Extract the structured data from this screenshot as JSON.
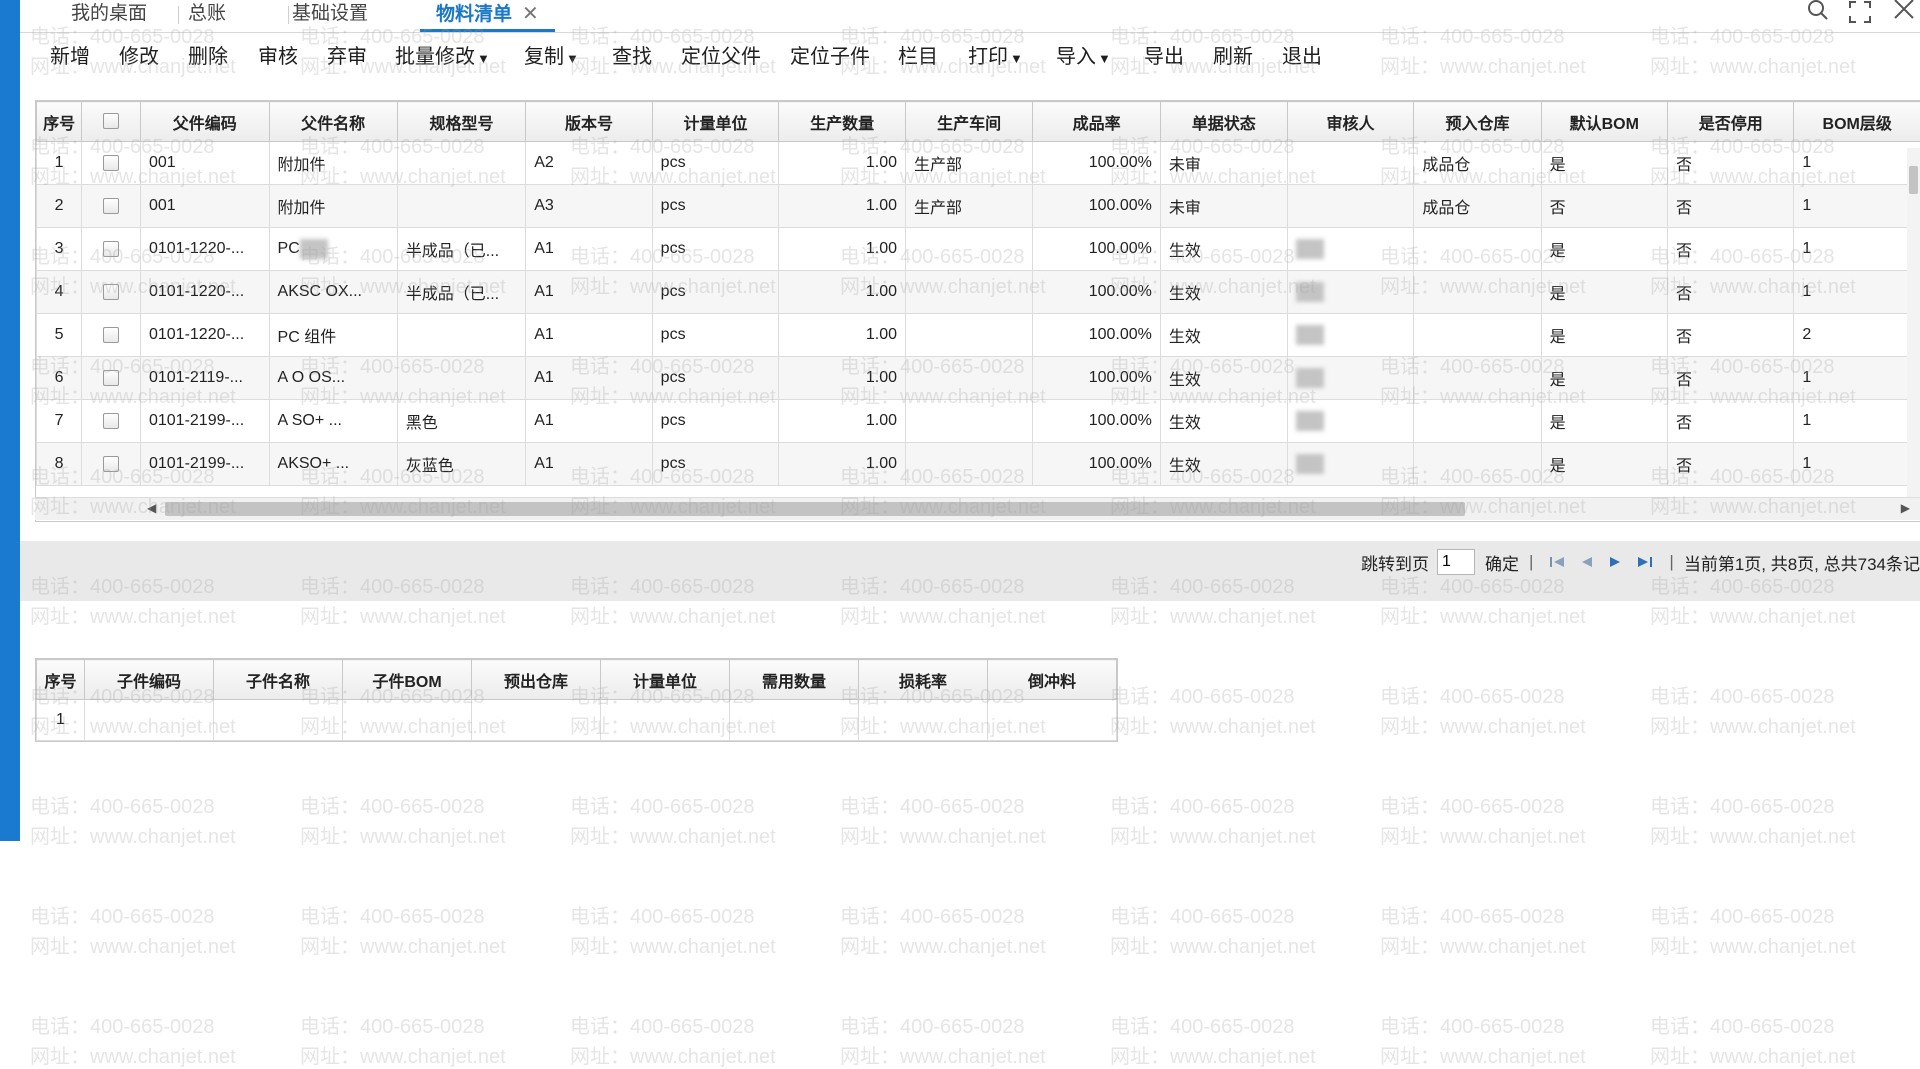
{
  "tabs": [
    {
      "label": "我的桌面"
    },
    {
      "label": "总账"
    },
    {
      "label": "基础设置"
    },
    {
      "label": "物料清单",
      "active": true,
      "close": "✕"
    }
  ],
  "toolbar": [
    {
      "label": "新增"
    },
    {
      "label": "修改"
    },
    {
      "label": "删除"
    },
    {
      "label": "审核"
    },
    {
      "label": "弃审"
    },
    {
      "label": "批量修改",
      "dropdown": true
    },
    {
      "label": "复制",
      "dropdown": true
    },
    {
      "label": "查找"
    },
    {
      "label": "定位父件"
    },
    {
      "label": "定位子件"
    },
    {
      "label": "栏目"
    },
    {
      "label": "打印",
      "dropdown": true
    },
    {
      "label": "导入",
      "dropdown": true
    },
    {
      "label": "导出"
    },
    {
      "label": "刷新"
    },
    {
      "label": "退出"
    }
  ],
  "main_grid": {
    "columns": [
      "序号",
      "",
      "父件编码",
      "父件名称",
      "规格型号",
      "版本号",
      "计量单位",
      "生产数量",
      "生产车间",
      "成品率",
      "单据状态",
      "审核人",
      "预入仓库",
      "默认BOM",
      "是否停用",
      "BOM层级"
    ],
    "rows": [
      [
        "1",
        "",
        "001",
        "附加件",
        "",
        "A2",
        "pcs",
        "1.00",
        "生产部",
        "100.00%",
        "未审",
        "",
        "成品仓",
        "是",
        "否",
        "1"
      ],
      [
        "2",
        "",
        "001",
        "附加件",
        "",
        "A3",
        "pcs",
        "1.00",
        "生产部",
        "100.00%",
        "未审",
        "",
        "成品仓",
        "否",
        "否",
        "1"
      ],
      [
        "3",
        "",
        "0101-1220-...",
        "PC",
        "半成品（已...",
        "A1",
        "pcs",
        "1.00",
        "",
        "100.00%",
        "生效",
        "",
        "",
        "是",
        "否",
        "1"
      ],
      [
        "4",
        "",
        "0101-1220-...",
        "AKSC  OX...",
        "半成品（已...",
        "A1",
        "pcs",
        "1.00",
        "",
        "100.00%",
        "生效",
        "",
        "",
        "是",
        "否",
        "1"
      ],
      [
        "5",
        "",
        "0101-1220-...",
        "PC  组件",
        "",
        "A1",
        "pcs",
        "1.00",
        "",
        "100.00%",
        "生效",
        "",
        "",
        "是",
        "否",
        "2"
      ],
      [
        "6",
        "",
        "0101-2119-...",
        "A  O OS...",
        "",
        "A1",
        "pcs",
        "1.00",
        "",
        "100.00%",
        "生效",
        "",
        "",
        "是",
        "否",
        "1"
      ],
      [
        "7",
        "",
        "0101-2199-...",
        "A  SO+ ...",
        "黑色",
        "A1",
        "pcs",
        "1.00",
        "",
        "100.00%",
        "生效",
        "",
        "",
        "是",
        "否",
        "1"
      ],
      [
        "8",
        "",
        "0101-2199-...",
        "AKSO+ ...",
        "灰蓝色",
        "A1",
        "pcs",
        "1.00",
        "",
        "100.00%",
        "生效",
        "",
        "",
        "是",
        "否",
        "1"
      ]
    ]
  },
  "pager": {
    "jump_label": "跳转到页",
    "page_value": "1",
    "confirm": "确定",
    "separator": "|",
    "status": "当前第1页, 共8页, 总共734条记"
  },
  "sub_grid": {
    "columns": [
      "序号",
      "子件编码",
      "子件名称",
      "子件BOM",
      "预出仓库",
      "计量单位",
      "需用数量",
      "损耗率",
      "倒冲料"
    ],
    "rows": [
      [
        "1",
        "",
        "",
        "",
        "",
        "",
        "",
        "",
        ""
      ]
    ]
  },
  "watermark": {
    "phone": "电话：400-665-0028",
    "site": "网址：www.chanjet.net"
  },
  "icons": {
    "search": "search-icon",
    "fullscreen": "fullscreen-icon",
    "close": "close-window-icon"
  },
  "colors": {
    "accent": "#1a78c6",
    "rail": "#1a7ad0"
  }
}
